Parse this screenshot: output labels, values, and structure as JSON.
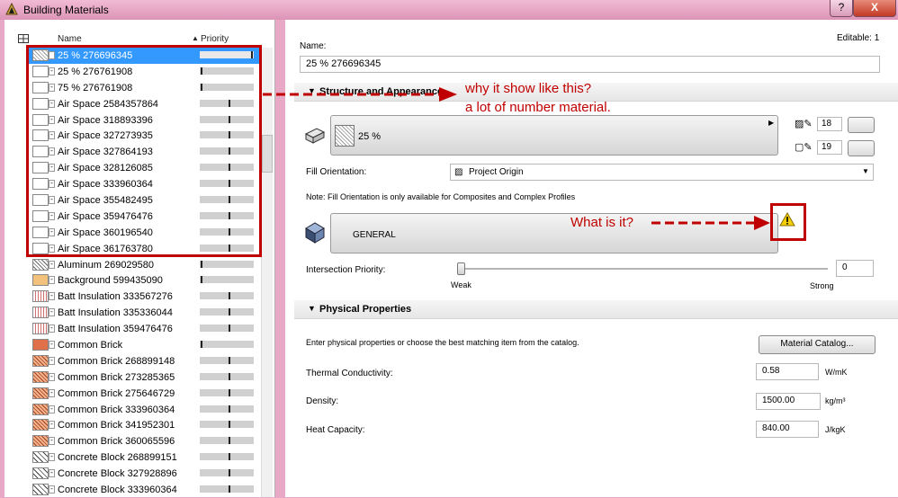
{
  "window": {
    "title": "Building Materials",
    "help_label": "?",
    "close_label": "X"
  },
  "list": {
    "col_name": "Name",
    "col_priority": "Priority",
    "items": [
      {
        "name": "25 % 276696345",
        "prio": 0.98,
        "selected": true
      },
      {
        "name": "25 % 276761908",
        "prio": 0.02
      },
      {
        "name": "75 % 276761908",
        "prio": 0.02
      },
      {
        "name": "Air Space 2584357864",
        "prio": 0.55
      },
      {
        "name": "Air Space 318893396",
        "prio": 0.55
      },
      {
        "name": "Air Space 327273935",
        "prio": 0.55
      },
      {
        "name": "Air Space 327864193",
        "prio": 0.55
      },
      {
        "name": "Air Space 328126085",
        "prio": 0.55
      },
      {
        "name": "Air Space 333960364",
        "prio": 0.55
      },
      {
        "name": "Air Space 355482495",
        "prio": 0.55
      },
      {
        "name": "Air Space 359476476",
        "prio": 0.55
      },
      {
        "name": "Air Space 360196540",
        "prio": 0.55
      },
      {
        "name": "Air Space 361763780",
        "prio": 0.55
      },
      {
        "name": "Aluminum 269029580",
        "prio": 0.02
      },
      {
        "name": "Background 599435090",
        "prio": 0.02
      },
      {
        "name": "Batt Insulation 333567276",
        "prio": 0.55
      },
      {
        "name": "Batt Insulation 335336044",
        "prio": 0.55
      },
      {
        "name": "Batt Insulation 359476476",
        "prio": 0.55
      },
      {
        "name": "Common Brick",
        "prio": 0.02
      },
      {
        "name": "Common Brick 268899148",
        "prio": 0.55
      },
      {
        "name": "Common Brick 273285365",
        "prio": 0.55
      },
      {
        "name": "Common Brick 275646729",
        "prio": 0.55
      },
      {
        "name": "Common Brick 333960364",
        "prio": 0.55
      },
      {
        "name": "Common Brick 341952301",
        "prio": 0.55
      },
      {
        "name": "Common Brick 360065596",
        "prio": 0.55
      },
      {
        "name": "Concrete Block 268899151",
        "prio": 0.55
      },
      {
        "name": "Concrete Block 327928896",
        "prio": 0.55
      },
      {
        "name": "Concrete Block 333960364",
        "prio": 0.55
      }
    ]
  },
  "form": {
    "editable": "Editable: 1",
    "name_label": "Name:",
    "name_value": "25 % 276696345",
    "section_structure": "Structure and Appearance",
    "fill_name": "25 %",
    "pen1_value": "18",
    "pen2_value": "19",
    "fill_orientation_label": "Fill Orientation:",
    "fill_orientation_value": "Project Origin",
    "note": "Note: Fill Orientation is only available for Composites and Complex Profiles",
    "surface_name": "GENERAL",
    "intersection_label": "Intersection Priority:",
    "intersection_value": "0",
    "intersection_level": 0,
    "weak_label": "Weak",
    "strong_label": "Strong",
    "section_physical": "Physical Properties",
    "physical_note": "Enter physical properties or choose the best matching item from the catalog.",
    "catalog_button": "Material Catalog...",
    "thermal_label": "Thermal Conductivity:",
    "thermal_value": "0.58",
    "thermal_unit": "W/mK",
    "density_label": "Density:",
    "density_value": "1500.00",
    "density_unit": "kg/m³",
    "heat_label": "Heat Capacity:",
    "heat_value": "840.00",
    "heat_unit": "J/kgK"
  },
  "annotations": {
    "note1_line1": "why it show like this?",
    "note1_line2": "a lot of number material.",
    "note2": "What is it?",
    "color": "#c00000"
  }
}
